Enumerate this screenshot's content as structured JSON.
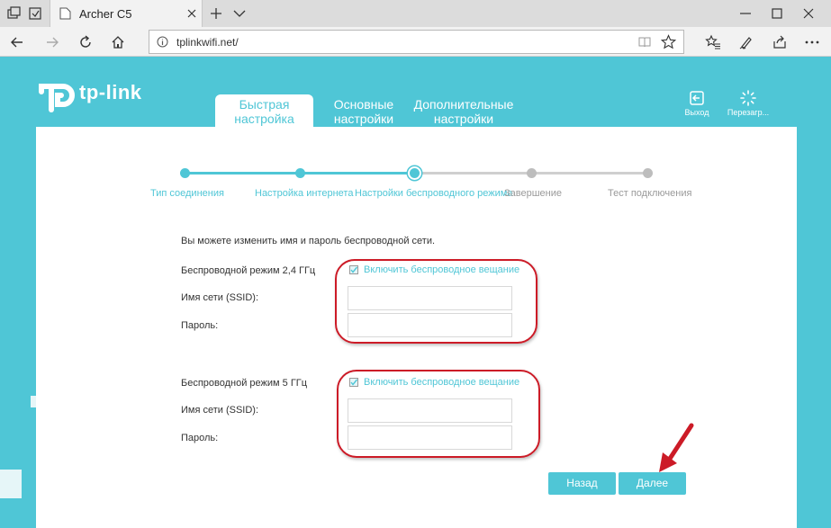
{
  "browser": {
    "tab_title": "Archer C5",
    "url": "tplinkwifi.net/",
    "icons": {
      "tab_actions": "tab-actions-icon",
      "tab_set": "tabs-aside-icon",
      "favicon": "page-icon",
      "tab_close": "close-icon",
      "new_tab": "plus-icon",
      "tab_list": "chevron-down-icon",
      "minimize": "minimize-icon",
      "maximize": "maximize-icon",
      "close": "close-icon",
      "back": "back-arrow-icon",
      "forward": "forward-arrow-icon",
      "refresh": "refresh-icon",
      "home": "home-icon",
      "info": "info-icon",
      "reading_view": "reading-view-icon",
      "favorite": "star-icon",
      "favorites_hub": "favorites-hub-icon",
      "pen": "pen-icon",
      "share": "share-icon",
      "more": "more-icon"
    }
  },
  "router": {
    "logo_text": "tp-link",
    "tabs": [
      {
        "label_line1": "Быстрая",
        "label_line2": "настройка",
        "active": true
      },
      {
        "label_line1": "Основные",
        "label_line2": "настройки",
        "active": false
      },
      {
        "label_line1": "Дополнительные",
        "label_line2": "настройки",
        "active": false
      }
    ],
    "actions": {
      "logout": "Выход",
      "reboot": "Перезагр..."
    },
    "steps": [
      {
        "label": "Тип соединения",
        "status": "done"
      },
      {
        "label": "Настройка интернета",
        "status": "done"
      },
      {
        "label": "Настройки беспроводного режима",
        "status": "current"
      },
      {
        "label": "Завершение",
        "status": "pending"
      },
      {
        "label": "Тест подключения",
        "status": "pending"
      }
    ],
    "intro": "Вы можете изменить имя и пароль беспроводной сети.",
    "band_24": {
      "label": "Беспроводной режим 2,4 ГГц",
      "enable_label": "Включить беспроводное вещание",
      "enabled": true,
      "ssid_label": "Имя сети (SSID):",
      "ssid_value": "",
      "password_label": "Пароль:",
      "password_value": ""
    },
    "band_5": {
      "label": "Беспроводной режим 5 ГГц",
      "enable_label": "Включить беспроводное вещание",
      "enabled": true,
      "ssid_label": "Имя сети (SSID):",
      "ssid_value": "",
      "password_label": "Пароль:",
      "password_value": ""
    },
    "buttons": {
      "back": "Назад",
      "next": "Далее"
    },
    "colors": {
      "accent": "#4fc6d6",
      "highlight": "#cc1b27",
      "pending": "#bdbdbd"
    }
  }
}
